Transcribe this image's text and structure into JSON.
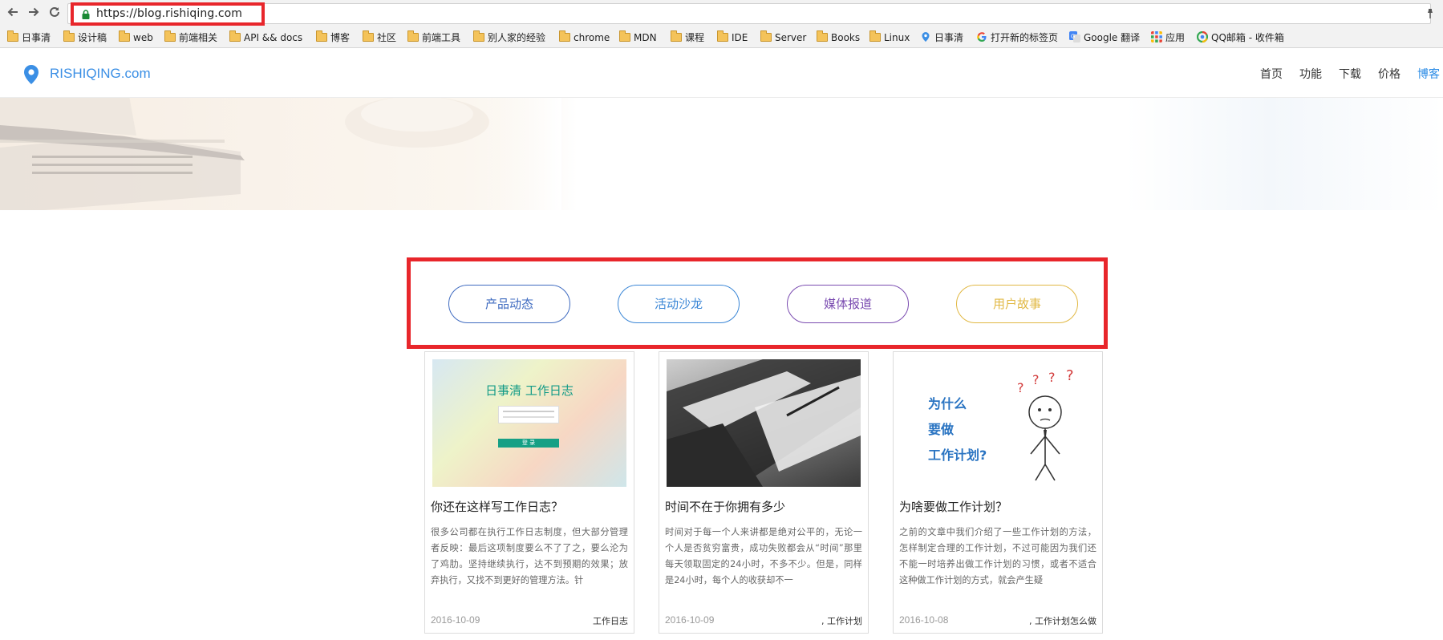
{
  "browser": {
    "url": "https://blog.rishiqing.com",
    "nav": {
      "back_icon": "arrow-left-icon",
      "forward_icon": "arrow-right-icon",
      "reload_icon": "reload-icon"
    },
    "bookmarks": [
      "日事清",
      "设计稿",
      "web",
      "前端相关",
      "API && docs",
      "博客",
      "社区",
      "前端工具",
      "别人家的经验",
      "chrome",
      "MDN",
      "课程",
      "IDE",
      "Server",
      "Books",
      "Linux",
      "日事清",
      "打开新的标签页",
      "Google 翻译",
      "应用",
      "QQ邮箱 - 收件箱"
    ]
  },
  "header": {
    "logo_text": "RISHIQING.com",
    "nav": [
      "首页",
      "功能",
      "下载",
      "价格",
      "博客"
    ],
    "active_nav": "博客"
  },
  "categories": [
    {
      "label": "产品动态",
      "color": "#3f6bc0"
    },
    {
      "label": "活动沙龙",
      "color": "#3a86d6"
    },
    {
      "label": "媒体报道",
      "color": "#7a4bb0"
    },
    {
      "label": "用户故事",
      "color": "#e1b843"
    }
  ],
  "articles": [
    {
      "image_title": "日事清 工作日志",
      "image_button": "登 录",
      "title": "你还在这样写工作日志？",
      "excerpt": "很多公司都在执行工作日志制度，但大部分管理者反映：最后这项制度要么不了了之，要么沦为了鸡肋。坚持继续执行，达不到预期的效果；放弃执行，又找不到更好的管理方法。针",
      "date": "2016-10-09",
      "tag": "工作日志"
    },
    {
      "title": "时间不在于你拥有多少",
      "excerpt": "时间对于每一个人来讲都是绝对公平的，无论一个人是否贫穷富贵，成功失败都会从“时间”那里每天领取固定的24小时，不多不少。但是，同样是24小时，每个人的收获却不一",
      "date": "2016-10-09",
      "tag": ", 工作计划"
    },
    {
      "image_lines": [
        "为什么",
        "要做",
        "工作计划?"
      ],
      "title": "为啥要做工作计划？",
      "excerpt": "之前的文章中我们介绍了一些工作计划的方法，怎样制定合理的工作计划，不过可能因为我们还不能一时培养出做工作计划的习惯，或者不适合这种做工作计划的方式，就会产生疑",
      "date": "2016-10-08",
      "tag": ", 工作计划怎么做"
    }
  ]
}
